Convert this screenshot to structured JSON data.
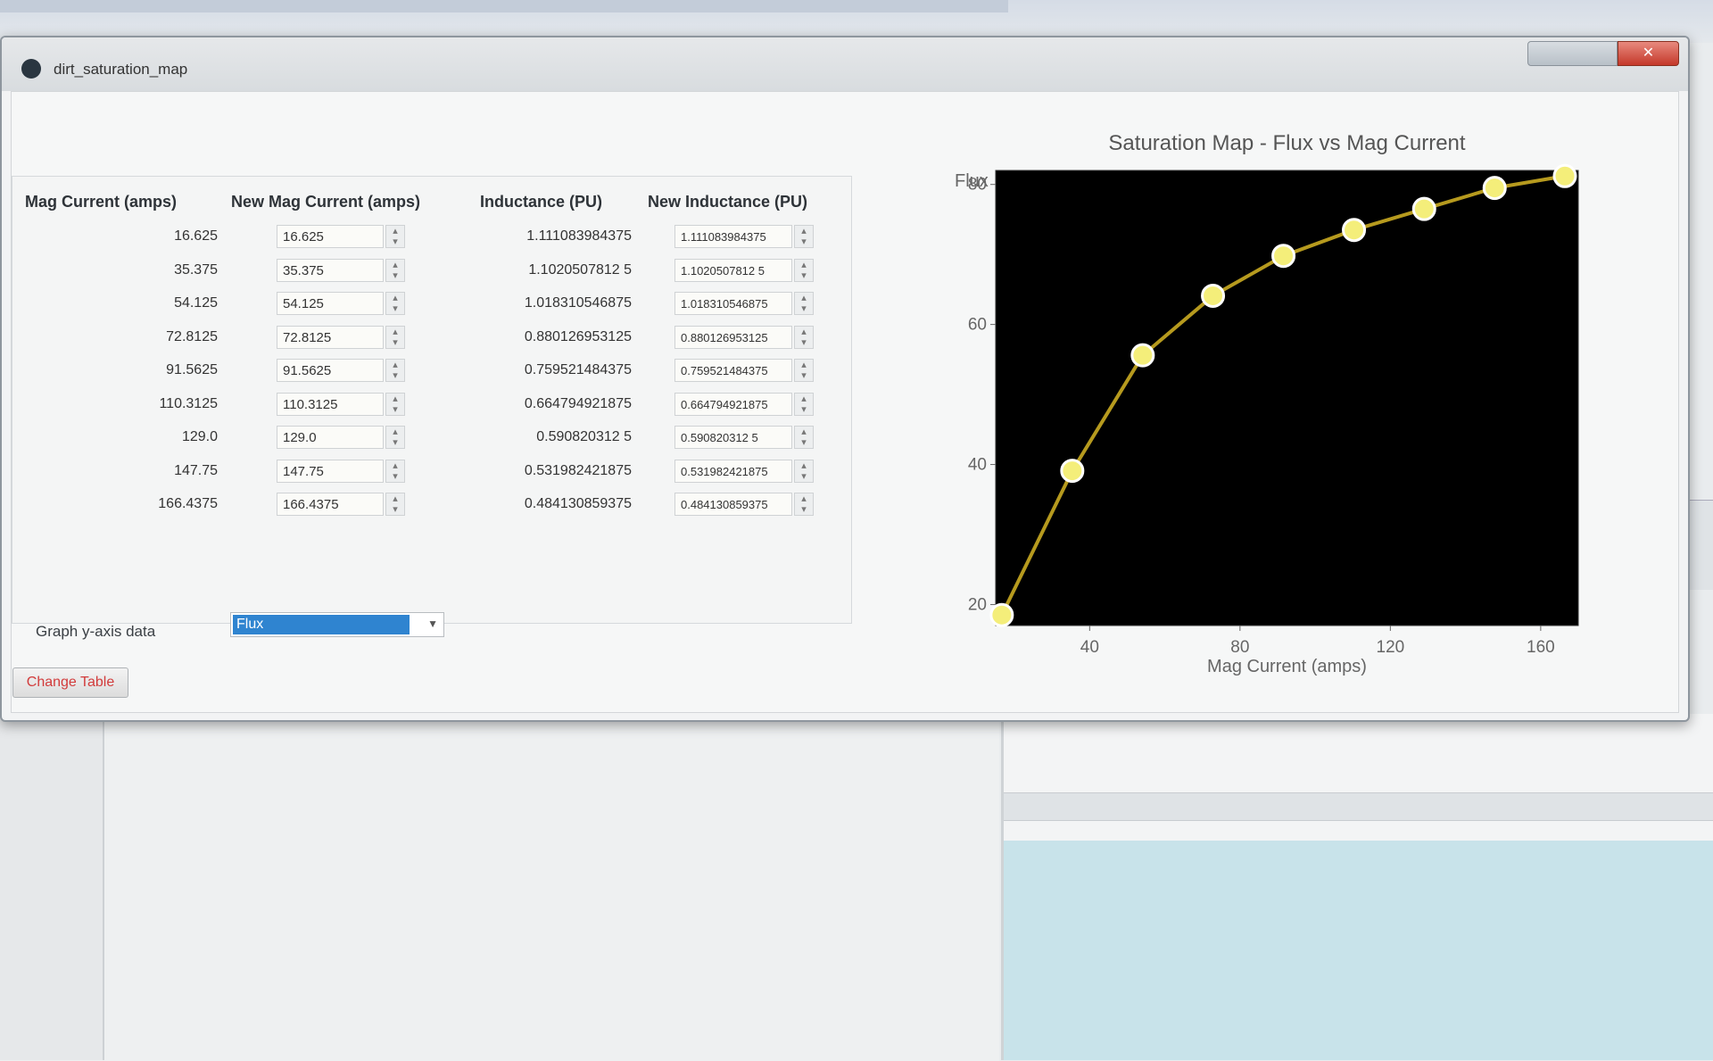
{
  "window": {
    "title": "dirt_saturation_map",
    "close_glyph": "✕"
  },
  "table": {
    "headers": [
      "Mag Current (amps)",
      "New Mag Current (amps)",
      "Inductance (PU)",
      "New Inductance (PU)"
    ],
    "rows": [
      {
        "mag": "16.625",
        "new_mag": "16.625",
        "ind": "1.111083984375",
        "new_ind": "1.111083984375"
      },
      {
        "mag": "35.375",
        "new_mag": "35.375",
        "ind": "1.1020507812 5",
        "new_ind": "1.1020507812 5"
      },
      {
        "mag": "54.125",
        "new_mag": "54.125",
        "ind": "1.018310546875",
        "new_ind": "1.018310546875"
      },
      {
        "mag": "72.8125",
        "new_mag": "72.8125",
        "ind": "0.880126953125",
        "new_ind": "0.880126953125"
      },
      {
        "mag": "91.5625",
        "new_mag": "91.5625",
        "ind": "0.759521484375",
        "new_ind": "0.759521484375"
      },
      {
        "mag": "110.3125",
        "new_mag": "110.3125",
        "ind": "0.664794921875",
        "new_ind": "0.664794921875"
      },
      {
        "mag": "129.0",
        "new_mag": "129.0",
        "ind": "0.590820312 5",
        "new_ind": "0.590820312 5"
      },
      {
        "mag": "147.75",
        "new_mag": "147.75",
        "ind": "0.531982421875",
        "new_ind": "0.531982421875"
      },
      {
        "mag": "166.4375",
        "new_mag": "166.4375",
        "ind": "0.484130859375",
        "new_ind": "0.484130859375"
      }
    ]
  },
  "controls": {
    "ydata_label": "Graph y-axis data",
    "ydata_value": "Flux",
    "change_table_button": "Change Table"
  },
  "icons": {
    "spin": "spin-arrows-icon",
    "combo_arrow": "chevron-down-icon",
    "app": "app-icon"
  },
  "colors": {
    "plot_background": "#000000",
    "line": "#b69a1e",
    "marker": "#f4ee7a",
    "selection": "#2f84d0",
    "button_text": "#d23b3b"
  },
  "chart_data": {
    "type": "line",
    "title": "Saturation Map - Flux vs Mag Current",
    "xlabel": "Mag Current (amps)",
    "ylabel": "Flux",
    "xlim": [
      15,
      170
    ],
    "ylim": [
      17,
      82
    ],
    "xticks": [
      40,
      80,
      120,
      160
    ],
    "yticks": [
      20,
      40,
      60,
      80
    ],
    "grid": false,
    "x": [
      16.625,
      35.375,
      54.125,
      72.8125,
      91.5625,
      110.3125,
      129.0,
      147.75,
      166.4375
    ],
    "series": [
      {
        "values": [
          18.5,
          39.1,
          55.6,
          64.1,
          69.8,
          73.5,
          76.5,
          79.5,
          81.2
        ]
      }
    ]
  }
}
